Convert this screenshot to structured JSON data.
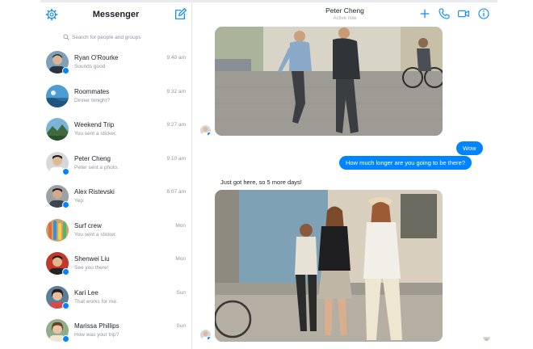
{
  "app": {
    "title": "Messenger"
  },
  "search": {
    "placeholder": "Search for people and groups"
  },
  "conversations": [
    {
      "name": "Ryan O'Rourke",
      "preview": "Sounds good",
      "time": "9:40 am",
      "messenger_badge": true
    },
    {
      "name": "Roommates",
      "preview": "Dinner tonight?",
      "time": "9:32 am",
      "messenger_badge": false
    },
    {
      "name": "Weekend Trip",
      "preview": "You sent a sticker.",
      "time": "9:27 am",
      "messenger_badge": false
    },
    {
      "name": "Peter Cheng",
      "preview": "Peter sent a photo.",
      "time": "9:10 am",
      "messenger_badge": true
    },
    {
      "name": "Alex Ristevski",
      "preview": "Yep.",
      "time": "8:07 am",
      "messenger_badge": true
    },
    {
      "name": "Surf crew",
      "preview": "You sent a sticker.",
      "time": "Mon",
      "messenger_badge": false
    },
    {
      "name": "Shenwei Liu",
      "preview": "See you there!",
      "time": "Mon",
      "messenger_badge": true
    },
    {
      "name": "Kari Lee",
      "preview": "That works for me.",
      "time": "Sun",
      "messenger_badge": true
    },
    {
      "name": "Marissa Phillips",
      "preview": "How was your trip?",
      "time": "Sun",
      "messenger_badge": true
    }
  ],
  "chat": {
    "contact_name": "Peter Cheng",
    "status": "Active now",
    "messages": [
      {
        "from": "them",
        "type": "photo",
        "content": "street-photo-couple"
      },
      {
        "from": "me",
        "type": "text",
        "text": "Wow"
      },
      {
        "from": "me",
        "type": "text",
        "text": "How much longer are you going to be there?"
      },
      {
        "from": "them",
        "type": "text",
        "text": "Just got here, so 5 more days!"
      },
      {
        "from": "them",
        "type": "photo",
        "content": "street-photo-three-women"
      }
    ]
  },
  "icons": {
    "settings": "gear-icon",
    "compose": "compose-icon",
    "search": "search-icon",
    "add": "plus-icon",
    "call": "phone-icon",
    "video": "video-icon",
    "info": "info-icon"
  },
  "colors": {
    "accent": "#0084ff",
    "text": "#1c1e21",
    "muted": "#90949c"
  }
}
